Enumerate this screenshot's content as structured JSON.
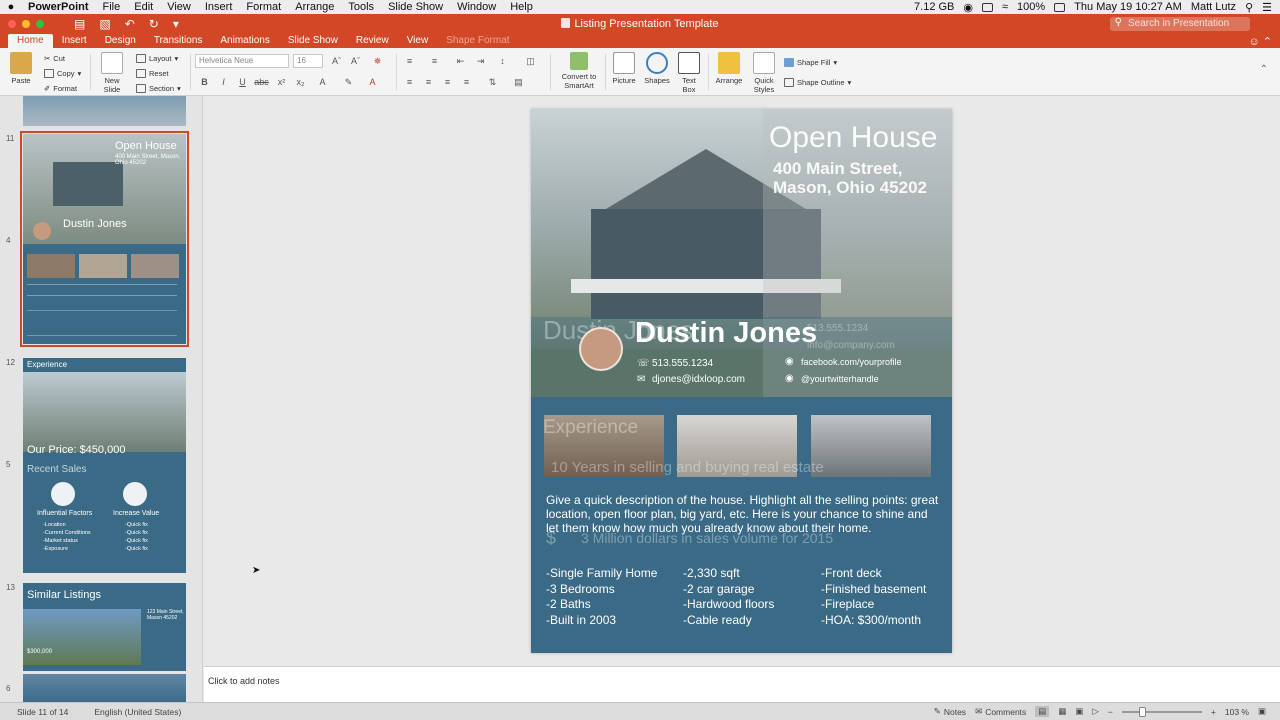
{
  "menubar": {
    "app": "PowerPoint",
    "items": [
      "File",
      "Edit",
      "View",
      "Insert",
      "Format",
      "Arrange",
      "Tools",
      "Slide Show",
      "Window",
      "Help"
    ],
    "memory": "7.12 GB",
    "battery": "100%",
    "datetime": "Thu May 19  10:27 AM",
    "user": "Matt Lutz"
  },
  "window": {
    "title": "Listing Presentation Template",
    "search_placeholder": "Search in Presentation"
  },
  "ribbon": {
    "tabs": [
      {
        "label": "Home",
        "active": true
      },
      {
        "label": "Insert"
      },
      {
        "label": "Design"
      },
      {
        "label": "Transitions"
      },
      {
        "label": "Animations"
      },
      {
        "label": "Slide Show"
      },
      {
        "label": "Review"
      },
      {
        "label": "View"
      },
      {
        "label": "Shape Format",
        "disabled": true
      }
    ],
    "paste": "Paste",
    "cut": "Cut",
    "copy": "Copy",
    "format": "Format",
    "new_slide": "New Slide",
    "layout": "Layout",
    "reset": "Reset",
    "section": "Section",
    "font_name": "Helvetica Neue",
    "font_size": "16",
    "convert_smartart": "Convert to SmartArt",
    "picture": "Picture",
    "shapes": "Shapes",
    "text_box": "Text Box",
    "arrange": "Arrange",
    "quick_styles": "Quick Styles",
    "shape_fill": "Shape Fill",
    "shape_outline": "Shape Outline"
  },
  "slides_panel": {
    "numbers": [
      "11",
      "4",
      "12",
      "5",
      "13",
      "6"
    ],
    "thumb11": {
      "title": "Open House",
      "address": "400 Main Street, Mason, Ohio 45202",
      "agent": "Dustin Jones"
    },
    "thumb12": {
      "heading": "Experience",
      "price": "Our Price: $450,000",
      "recent": "Recent Sales",
      "factors": "Influential Factors",
      "increase": "Increase Value",
      "factor_items": [
        "-Location",
        "-Current Conditions",
        "-Market status",
        "-Exposure"
      ],
      "value_items": [
        "-Quick fix",
        "-Quick fix",
        "-Quick fix",
        "-Quick fix"
      ]
    },
    "thumb13": {
      "heading": "Similar Listings",
      "price": "$300,000",
      "address": "123 Main Street, Mason 45202"
    }
  },
  "slide": {
    "title": "Open House",
    "address_line1": "400 Main Street,",
    "address_line2": "Mason, Ohio 45202",
    "agent_name": "Dustin Jones",
    "phone": "513.555.1234",
    "email": "djones@idxloop.com",
    "facebook": "facebook.com/yourprofile",
    "twitter": "@yourtwitterhandle",
    "ghost_phone": "513.555.1234",
    "ghost_email": "info@company.com",
    "ghost_name": "Dustin Jones",
    "ghost_experience": "Experience",
    "ghost_years": "10  Years in selling and buying real estate",
    "ghost_sales": "3 Million dollars in sales volume for 2015",
    "description": "Give a quick description of the house. Highlight all the selling points: great location, open floor plan, big yard, etc. Here is your chance to shine and let them know how much you already know about their home.",
    "features_col1": [
      "-Single Family Home",
      "-3 Bedrooms",
      "-2 Baths",
      "-Built in 2003"
    ],
    "features_col2": [
      "-2,330 sqft",
      "-2 car garage",
      "-Hardwood floors",
      "-Cable ready"
    ],
    "features_col3": [
      "-Front deck",
      "-Finished basement",
      "-Fireplace",
      "-HOA: $300/month"
    ]
  },
  "notes": {
    "placeholder": "Click to add notes"
  },
  "status": {
    "slide_info": "Slide 11 of 14",
    "language": "English (United States)",
    "notes": "Notes",
    "comments": "Comments",
    "zoom": "103 %",
    "zoom_level_pct": 103
  },
  "colors": {
    "accent": "#d24726",
    "slide_blue": "#3a6a85"
  }
}
